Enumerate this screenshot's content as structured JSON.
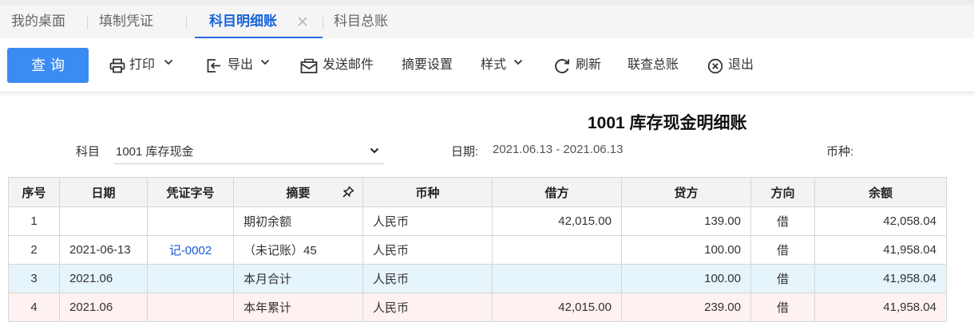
{
  "tabs": [
    {
      "label": "我的桌面",
      "active": false
    },
    {
      "label": "填制凭证",
      "active": false
    },
    {
      "label": "科目明细账",
      "active": true
    },
    {
      "label": "科目总账",
      "active": false
    }
  ],
  "toolbar": {
    "query_label": "查询",
    "print_label": "打印",
    "export_label": "导出",
    "email_label": "发送邮件",
    "summary_settings_label": "摘要设置",
    "style_label": "样式",
    "refresh_label": "刷新",
    "linked_ledger_label": "联查总账",
    "exit_label": "退出"
  },
  "report": {
    "title": "1001 库存现金明细账",
    "subject_label": "科目",
    "subject_value": "1001 库存现金",
    "date_label": "日期:",
    "date_range": "2021.06.13 - 2021.06.13",
    "currency_label": "币种:"
  },
  "table": {
    "columns": [
      "序号",
      "日期",
      "凭证字号",
      "摘要",
      "币种",
      "借方",
      "贷方",
      "方向",
      "余额"
    ],
    "rows": [
      {
        "no": "1",
        "date": "",
        "voucher": "",
        "summary": "期初余额",
        "currency": "人民币",
        "debit": "42,015.00",
        "credit": "139.00",
        "direction": "借",
        "balance": "42,058.04",
        "type": "normal"
      },
      {
        "no": "2",
        "date": "2021-06-13",
        "voucher": "记-0002",
        "summary": "（未记账）45",
        "currency": "人民币",
        "debit": "",
        "credit": "100.00",
        "direction": "借",
        "balance": "41,958.04",
        "type": "normal"
      },
      {
        "no": "3",
        "date": "2021.06",
        "voucher": "",
        "summary": "本月合计",
        "currency": "人民币",
        "debit": "",
        "credit": "100.00",
        "direction": "借",
        "balance": "41,958.04",
        "type": "month"
      },
      {
        "no": "4",
        "date": "2021.06",
        "voucher": "",
        "summary": "本年累计",
        "currency": "人民币",
        "debit": "42,015.00",
        "credit": "239.00",
        "direction": "借",
        "balance": "41,958.04",
        "type": "year"
      }
    ]
  },
  "icons": {
    "print": "printer-icon",
    "export": "export-icon",
    "email": "mail-icon",
    "refresh": "refresh-icon",
    "exit": "close-circle-icon",
    "tab_close": "close-icon",
    "column_pin": "pin-icon"
  },
  "colors": {
    "accent": "#2a6ae0",
    "primary_button": "#3b8cf2",
    "month_row": "#e6f4fb",
    "year_row": "#fdf1f1",
    "link": "#1a57d6"
  }
}
